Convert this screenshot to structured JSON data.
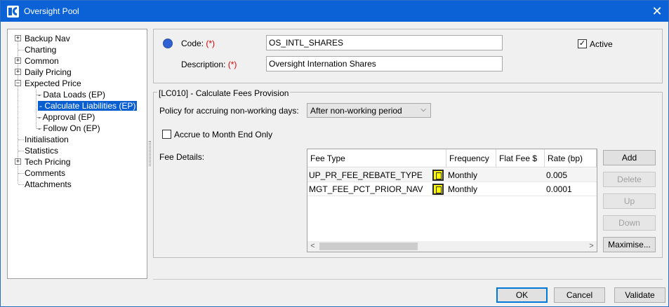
{
  "window": {
    "title": "Oversight Pool",
    "close_glyph": "✕"
  },
  "tree": {
    "items": [
      {
        "label": "Backup Nav",
        "expander": "+"
      },
      {
        "label": "Charting"
      },
      {
        "label": "Common",
        "expander": "+"
      },
      {
        "label": "Daily Pricing",
        "expander": "+"
      },
      {
        "label": "Expected Price",
        "expander": "−"
      },
      {
        "label": "- Data Loads (EP)"
      },
      {
        "label": "- Calculate Liabilities (EP)",
        "selected": true
      },
      {
        "label": "- Approval (EP)"
      },
      {
        "label": "- Follow On (EP)"
      },
      {
        "label": "Initialisation"
      },
      {
        "label": "Statistics"
      },
      {
        "label": "Tech Pricing",
        "expander": "+"
      },
      {
        "label": "Comments"
      },
      {
        "label": "Attachments"
      }
    ]
  },
  "header": {
    "status_color": "#3062d4",
    "code_label": "Code:",
    "description_label": "Description:",
    "required_mark": "(*)",
    "code_value": "OS_INTL_SHARES",
    "description_value": "Oversight Internation Shares",
    "active_label": "Active",
    "active_checked": true,
    "check_glyph": "✓"
  },
  "provision": {
    "group_title": "[LC010] - Calculate Fees Provision",
    "policy_label": "Policy for accruing non-working days:",
    "policy_value": "After non-working period",
    "accrue_label": "Accrue to Month End Only",
    "accrue_checked": false,
    "fee_details_label": "Fee Details:",
    "table": {
      "columns": [
        "Fee Type",
        "Frequency",
        "Flat Fee $",
        "Rate (bp)"
      ],
      "rows": [
        {
          "fee_type": "UP_PR_FEE_REBATE_TYPE",
          "frequency": "Monthly",
          "flat_fee": "",
          "rate": "0.005"
        },
        {
          "fee_type": "MGT_FEE_PCT_PRIOR_NAV",
          "frequency": "Monthly",
          "flat_fee": "",
          "rate": "0.0001"
        }
      ],
      "scroll_left": "<",
      "scroll_right": ">"
    },
    "side_buttons": {
      "add": "Add",
      "delete": "Delete",
      "up": "Up",
      "down": "Down",
      "maximise": "Maximise..."
    }
  },
  "footer": {
    "ok": "OK",
    "cancel": "Cancel",
    "validate": "Validate"
  }
}
